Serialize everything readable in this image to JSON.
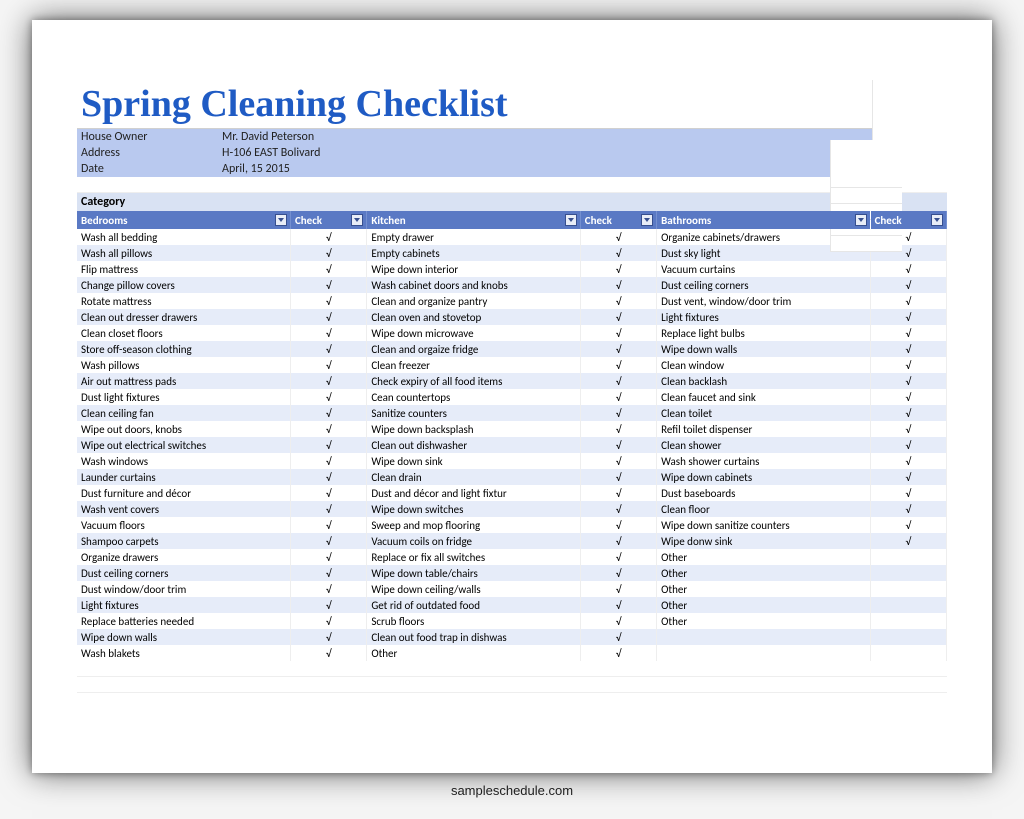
{
  "title": "Spring Cleaning Checklist",
  "info": {
    "owner_label": "House Owner",
    "owner_value": "Mr. David Peterson",
    "address_label": "Address",
    "address_value": "H-106 EAST Bolivard",
    "date_label": "Date",
    "date_value": "April, 15 2015"
  },
  "category_label": "Category",
  "columns": {
    "c1": "Bedrooms",
    "c2": "Check",
    "c3": "Kitchen",
    "c4": "Check",
    "c5": "Bathrooms",
    "c6": "Check"
  },
  "check_mark": "√",
  "rows": [
    {
      "b": "Wash all bedding",
      "bc": "√",
      "k": "Empty drawer",
      "kc": "√",
      "t": "Organize cabinets/drawers",
      "tc": "√"
    },
    {
      "b": "Wash all pillows",
      "bc": "√",
      "k": "Empty cabinets",
      "kc": "√",
      "t": "Dust sky light",
      "tc": "√"
    },
    {
      "b": "Flip mattress",
      "bc": "√",
      "k": "Wipe down interior",
      "kc": "√",
      "t": "Vacuum curtains",
      "tc": "√"
    },
    {
      "b": "Change pillow covers",
      "bc": "√",
      "k": "Wash cabinet doors and knobs",
      "kc": "√",
      "t": "Dust ceiling corners",
      "tc": "√"
    },
    {
      "b": "Rotate mattress",
      "bc": "√",
      "k": "Clean and organize pantry",
      "kc": "√",
      "t": "Dust vent, window/door trim",
      "tc": "√"
    },
    {
      "b": "Clean out dresser drawers",
      "bc": "√",
      "k": "Clean oven and stovetop",
      "kc": "√",
      "t": "Light fixtures",
      "tc": "√"
    },
    {
      "b": "Clean closet floors",
      "bc": "√",
      "k": "Wipe down microwave",
      "kc": "√",
      "t": "Replace light bulbs",
      "tc": "√"
    },
    {
      "b": "Store off-season clothing",
      "bc": "√",
      "k": "Clean and orgaize fridge",
      "kc": "√",
      "t": "Wipe down walls",
      "tc": "√"
    },
    {
      "b": "Wash pillows",
      "bc": "√",
      "k": "Clean freezer",
      "kc": "√",
      "t": "Clean window",
      "tc": "√"
    },
    {
      "b": "Air out mattress pads",
      "bc": "√",
      "k": "Check expiry of all food items",
      "kc": "√",
      "t": "Clean backlash",
      "tc": "√"
    },
    {
      "b": "Dust light fixtures",
      "bc": "√",
      "k": "Cean countertops",
      "kc": "√",
      "t": "Clean faucet and sink",
      "tc": "√"
    },
    {
      "b": "Clean ceiling fan",
      "bc": "√",
      "k": "Sanitize counters",
      "kc": "√",
      "t": "Clean toilet",
      "tc": "√"
    },
    {
      "b": "Wipe out doors, knobs",
      "bc": "√",
      "k": "Wipe down backsplash",
      "kc": "√",
      "t": "Refil toilet dispenser",
      "tc": "√"
    },
    {
      "b": "Wipe out electrical switches",
      "bc": "√",
      "k": "Clean out dishwasher",
      "kc": "√",
      "t": "Clean shower",
      "tc": "√"
    },
    {
      "b": "Wash windows",
      "bc": "√",
      "k": "Wipe down sink",
      "kc": "√",
      "t": "Wash shower curtains",
      "tc": "√"
    },
    {
      "b": "Launder curtains",
      "bc": "√",
      "k": "Clean drain",
      "kc": "√",
      "t": "Wipe down cabinets",
      "tc": "√"
    },
    {
      "b": "Dust furniture and décor",
      "bc": "√",
      "k": "Dust and décor and light fixtur",
      "kc": "√",
      "t": "Dust baseboards",
      "tc": "√"
    },
    {
      "b": "Wash vent covers",
      "bc": "√",
      "k": "Wipe down switches",
      "kc": "√",
      "t": "Clean floor",
      "tc": "√"
    },
    {
      "b": "Vacuum floors",
      "bc": "√",
      "k": "Sweep and mop flooring",
      "kc": "√",
      "t": "Wipe down sanitize counters",
      "tc": "√"
    },
    {
      "b": "Shampoo carpets",
      "bc": "√",
      "k": "Vacuum coils on fridge",
      "kc": "√",
      "t": "Wipe donw sink",
      "tc": "√"
    },
    {
      "b": "Organize drawers",
      "bc": "√",
      "k": "Replace or fix all switches",
      "kc": "√",
      "t": "Other",
      "tc": ""
    },
    {
      "b": "Dust ceiling corners",
      "bc": "√",
      "k": "Wipe down table/chairs",
      "kc": "√",
      "t": "Other",
      "tc": ""
    },
    {
      "b": "Dust window/door trim",
      "bc": "√",
      "k": "Wipe down ceiling/walls",
      "kc": "√",
      "t": "Other",
      "tc": ""
    },
    {
      "b": "Light fixtures",
      "bc": "√",
      "k": "Get rid of outdated  food",
      "kc": "√",
      "t": "Other",
      "tc": ""
    },
    {
      "b": "Replace batteries needed",
      "bc": "√",
      "k": "Scrub floors",
      "kc": "√",
      "t": "Other",
      "tc": ""
    },
    {
      "b": "Wipe down walls",
      "bc": "√",
      "k": "Clean out food trap in dishwas",
      "kc": "√",
      "t": "",
      "tc": ""
    },
    {
      "b": "Wash blakets",
      "bc": "√",
      "k": "Other",
      "kc": "√",
      "t": "",
      "tc": ""
    }
  ],
  "watermark": "sampleschedule.com"
}
